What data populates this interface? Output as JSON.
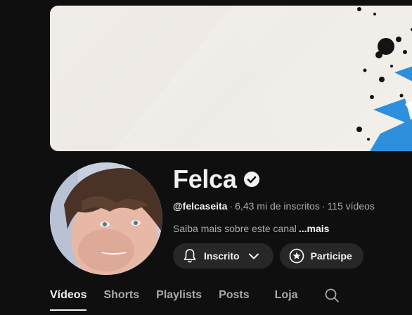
{
  "channel": {
    "name": "Felca",
    "handle": "@felcaseita",
    "subscribers": "6,43 mi de inscritos",
    "videos": "115 vídeos",
    "separator": "·",
    "about": "Saiba mais sobre este canal",
    "more_label": "...mais",
    "verified_icon": "verified-check-icon",
    "avatar_icon": "channel-avatar"
  },
  "actions": {
    "subscribed_label": "Inscrito",
    "subscribed_icons": [
      "bell-icon",
      "chevron-down-icon"
    ],
    "join_label": "Participe",
    "join_icon": "star-badge-icon"
  },
  "tabs": [
    {
      "label": "Vídeos",
      "active": true
    },
    {
      "label": "Shorts",
      "active": false
    },
    {
      "label": "Playlists",
      "active": false
    },
    {
      "label": "Posts",
      "active": false
    },
    {
      "label": "Loja",
      "active": false
    }
  ],
  "tab_search_icon": "search-icon",
  "colors": {
    "background": "#0f0f0f",
    "button": "#272727",
    "text": "#f1f1f1",
    "secondary_text": "#aaaaaa",
    "banner_accent": "#2e8fdc"
  }
}
